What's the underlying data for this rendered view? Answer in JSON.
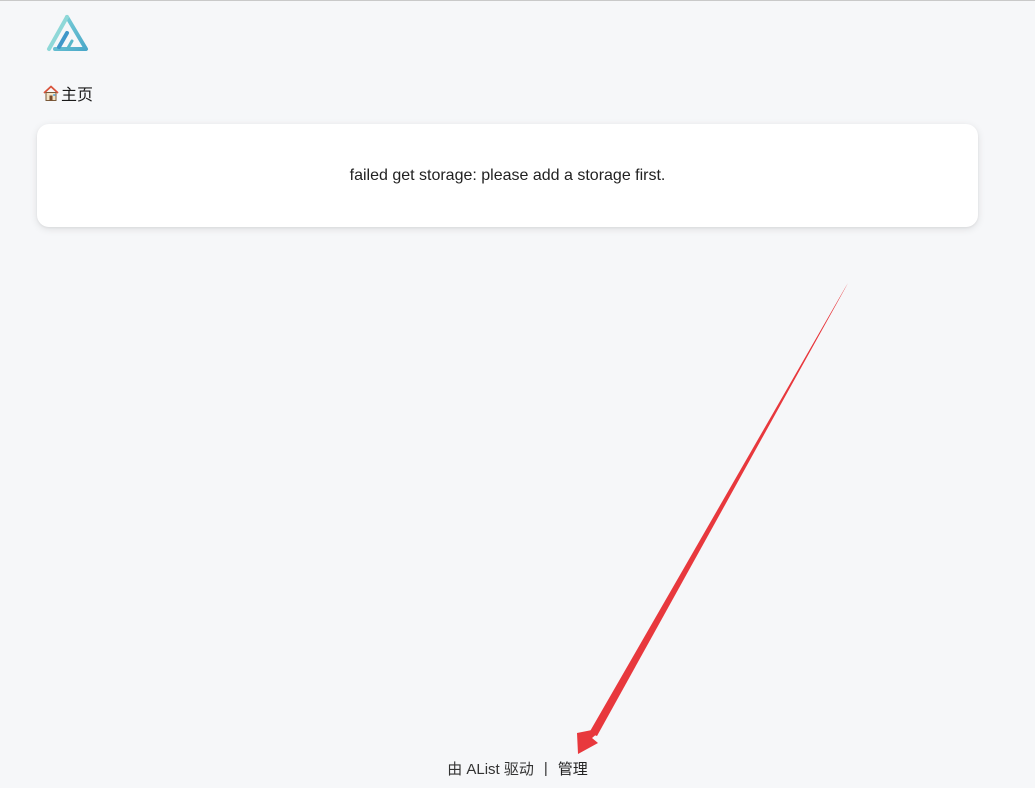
{
  "logo": {
    "icon": "alist-logo-icon",
    "color": "#5fc0d0"
  },
  "breadcrumb": {
    "icon": "home-icon",
    "label": "主页"
  },
  "card": {
    "message": "failed get storage: please add a storage first."
  },
  "footer": {
    "powered_by": "由 AList 驱动",
    "separator": "|",
    "admin_link": "管理"
  },
  "annotation": {
    "arrow_color": "#e8383d"
  }
}
